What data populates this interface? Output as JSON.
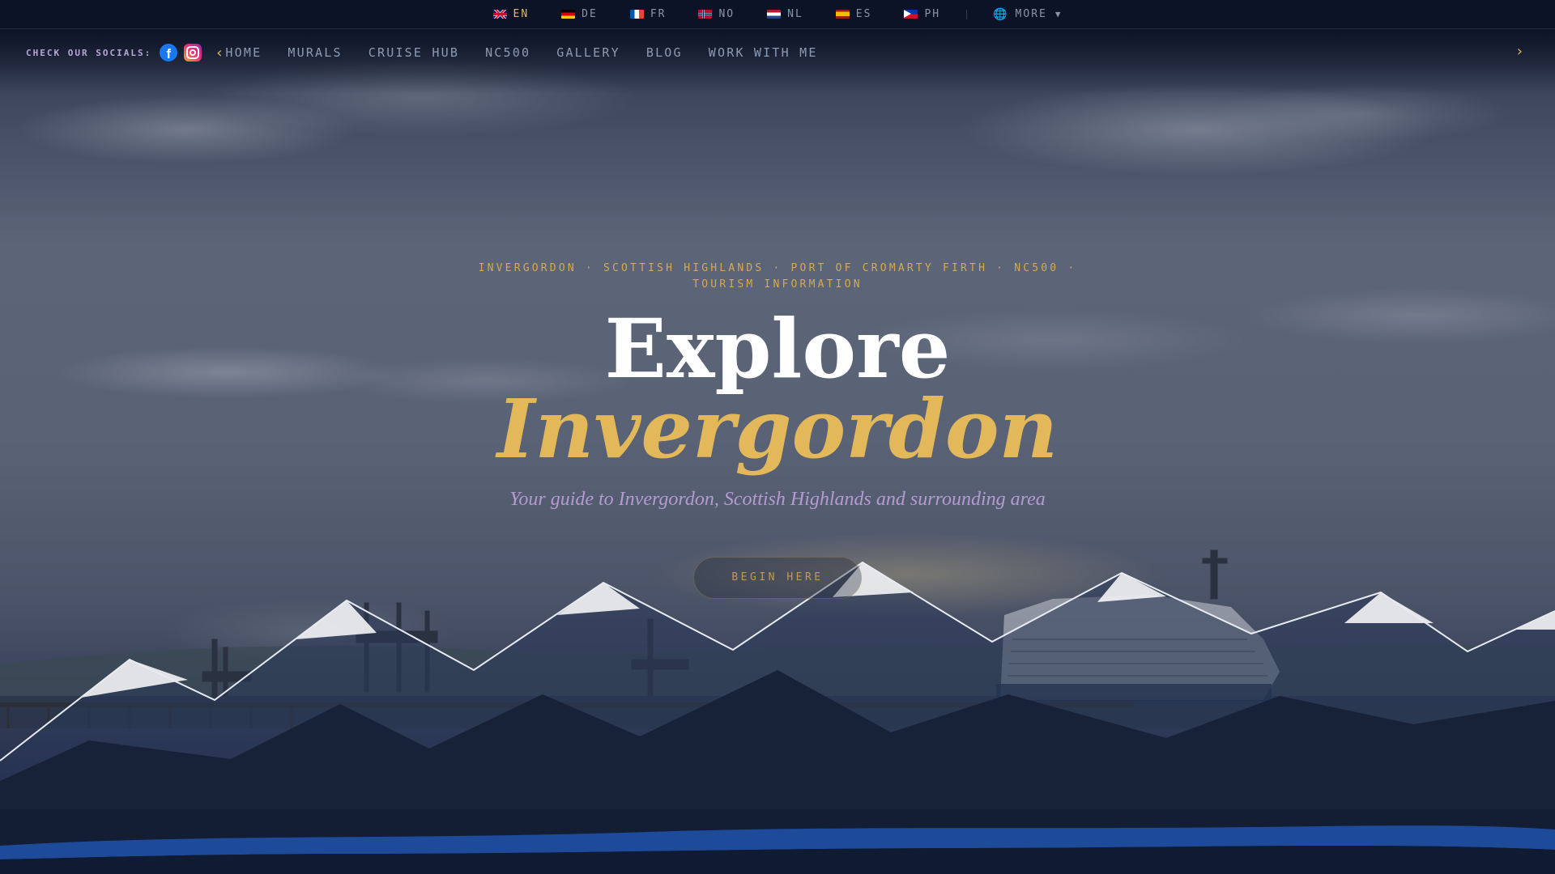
{
  "languages": [
    {
      "code": "EN",
      "flag": "flag-en",
      "active": true
    },
    {
      "code": "DE",
      "flag": "flag-de",
      "active": false
    },
    {
      "code": "FR",
      "flag": "flag-fr",
      "active": false
    },
    {
      "code": "NO",
      "flag": "flag-no",
      "active": false
    },
    {
      "code": "NL",
      "flag": "flag-nl",
      "active": false
    },
    {
      "code": "ES",
      "flag": "flag-es",
      "active": false
    },
    {
      "code": "PH",
      "flag": "flag-ph",
      "active": false
    }
  ],
  "lang_more": {
    "label": "MORE",
    "icon": "globe-icon",
    "caret": "▼"
  },
  "socials": {
    "label": "CHECK OUR SOCIALS:",
    "icons": [
      "facebook-icon",
      "instagram-icon"
    ]
  },
  "nav": {
    "items": [
      "HOME",
      "MURALS",
      "CRUISE HUB",
      "NC500",
      "GALLERY",
      "BLOG",
      "WORK WITH ME"
    ],
    "prev_icon": "chevron-left-icon",
    "next_icon": "chevron-right-icon"
  },
  "hero": {
    "eyebrow_line1": "INVERGORDON · SCOTTISH HIGHLANDS · PORT OF CROMARTY FIRTH · NC500 ·",
    "eyebrow_line2": "TOURISM INFORMATION",
    "title_line1": "Explore",
    "title_line2": "Invergordon",
    "subtitle": "Your guide to Invergordon, Scottish Highlands and surrounding area",
    "cta": "BEGIN HERE"
  },
  "colors": {
    "accent_gold": "#e3b85a",
    "navy": "#0f1a33",
    "lavender": "#b49bd0",
    "wave_blue": "#1e4a9a"
  }
}
